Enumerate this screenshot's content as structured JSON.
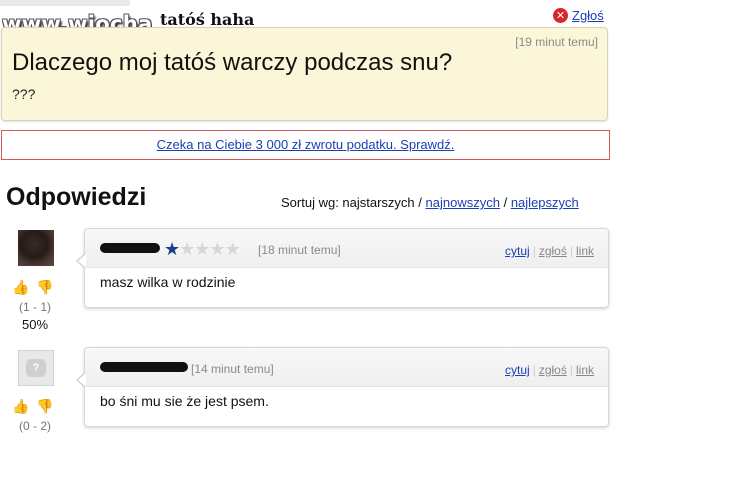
{
  "overlay": {
    "logo_text": "www.wiocha.pl",
    "meme_text": "tatóś haha"
  },
  "top": {
    "report_label": "Zgłoś"
  },
  "question": {
    "time": "[19 minut temu]",
    "title": "Dlaczego moj tatóś warczy podczas snu?",
    "body": "???"
  },
  "ad": {
    "text": "Czeka na Ciebie 3 000 zł zwrotu podatku. Sprawdź."
  },
  "answers_section": {
    "heading": "Odpowiedzi",
    "sort_label": "Sortuj wg: najstarszych /",
    "sort_newest": "najnowszych",
    "sort_sep": "/",
    "sort_best": "najlepszych"
  },
  "answers": [
    {
      "time": "[18 minut temu]",
      "rating": 1,
      "rating_max": 5,
      "text": "masz wilka w rodzinie",
      "score": "(1 - 1)",
      "percent": "50%",
      "actions": {
        "quote": "cytuj",
        "report": "zgłoś",
        "link": "link"
      }
    },
    {
      "time": "[14 minut temu]",
      "text": "bo śni mu sie że jest psem.",
      "score": "(0 - 2)",
      "avatar_label": "?",
      "actions": {
        "quote": "cytuj",
        "report": "zgłoś",
        "link": "link"
      }
    }
  ],
  "icons": {
    "report": "close-circle-icon",
    "thumb_up": "thumb-up-icon",
    "thumb_down": "thumb-down-icon",
    "star": "star-icon"
  },
  "colors": {
    "link": "#1a3fb5",
    "question_bg": "#fbf6d8",
    "ad_border": "#d6595b",
    "report_icon": "#d9262a",
    "star_on": "#1b3f8f"
  }
}
